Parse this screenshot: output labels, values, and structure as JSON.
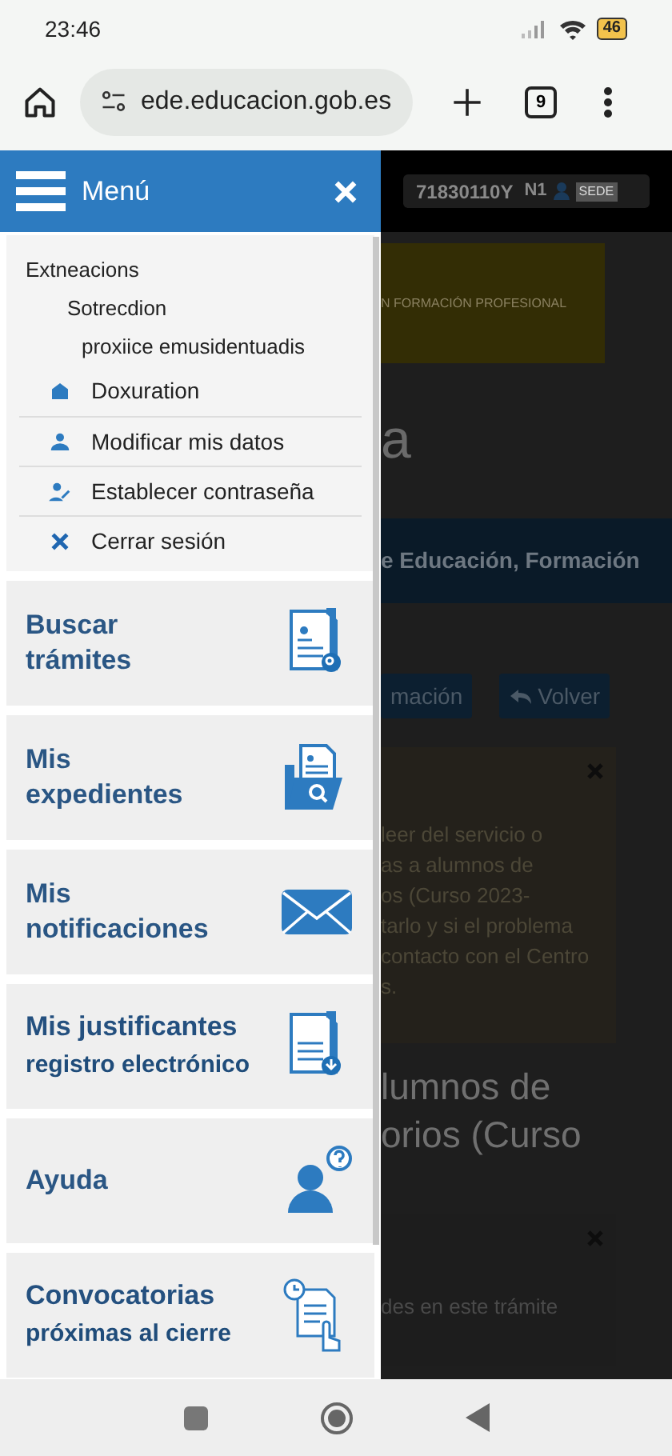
{
  "status_bar": {
    "time": "23:46",
    "battery": "46"
  },
  "browser": {
    "url": "ede.educacion.gob.es",
    "tab_count": "9"
  },
  "menu": {
    "title": "Menú",
    "tree": [
      {
        "label": "Extneacions",
        "children": [
          {
            "label": "Sotrecdion",
            "children": [
              {
                "label": "proxiice emusidentuadis"
              }
            ]
          }
        ]
      }
    ],
    "account_items": [
      {
        "label": "Doxuration"
      },
      {
        "label": "Modificar mis datos"
      },
      {
        "label": "Establecer contraseña"
      },
      {
        "label": "Cerrar sesión"
      }
    ],
    "cards": [
      {
        "title": "Buscar trámites"
      },
      {
        "title": "Mis expedientes"
      },
      {
        "title": "Mis notificaciones"
      },
      {
        "title": "Mis justificantes",
        "subtitle": "registro electrónico"
      },
      {
        "title": "Ayuda"
      },
      {
        "title": "Convocatorias",
        "subtitle": "próximas al cierre"
      }
    ]
  },
  "background_page": {
    "user_id": "71830110Y",
    "user_level": "N1",
    "role_tag": "SEDE",
    "banner": "N FORMACIÓN PROFESIONAL",
    "title_fragment": "a",
    "band": "e Educación, Formación",
    "buttons": [
      "mación",
      "Volver"
    ],
    "notice_lines": [
      "leer del servicio o",
      "as a alumnos de",
      "os (Curso 2023-",
      "tarlo y si el problema",
      "contacto con el Centro",
      "s."
    ],
    "heading_lines": [
      "lumnos de",
      "orios (Curso"
    ],
    "notice2": "des en este trámite"
  }
}
